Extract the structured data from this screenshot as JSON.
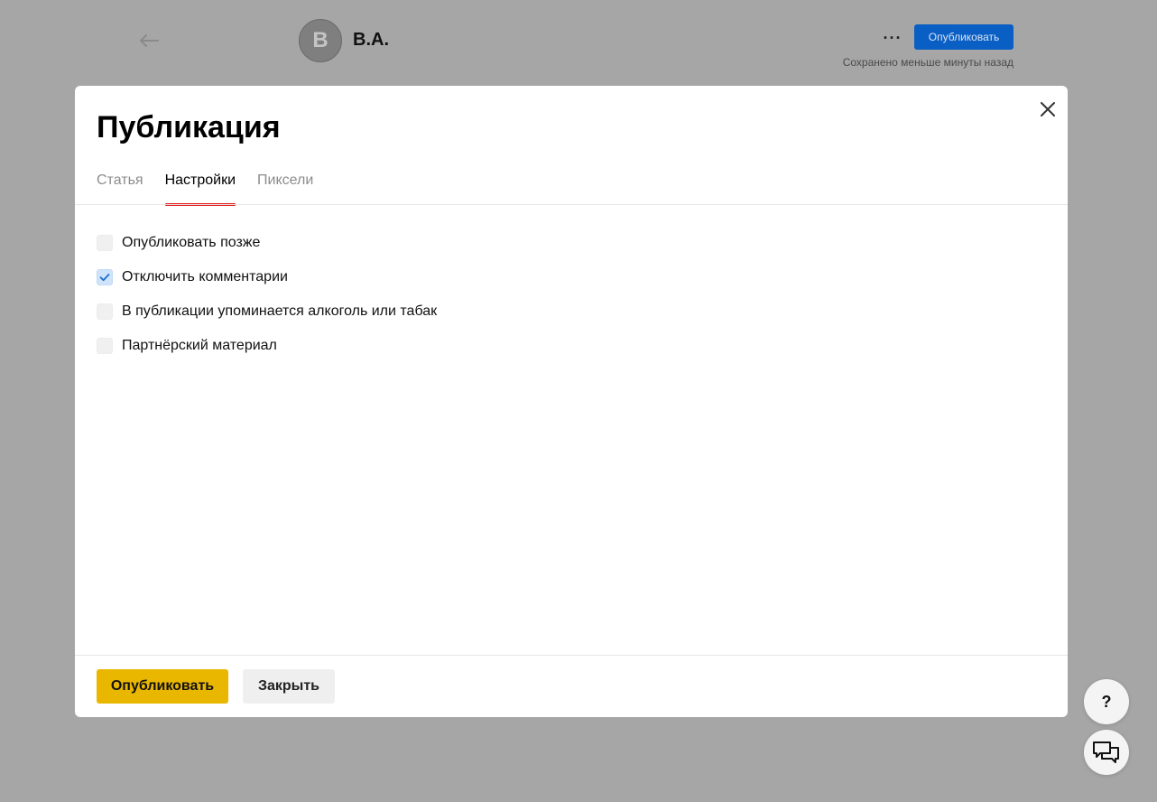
{
  "header": {
    "back_icon": "arrow-left-icon",
    "avatar_letter": "B",
    "author_name": "B.A.",
    "more_icon": "more-dots-icon",
    "more_text": "···",
    "publish_label": "Опубликовать",
    "saved_status": "Сохранено меньше минуты назад"
  },
  "modal": {
    "title": "Публикация",
    "close_icon": "close-icon",
    "tabs": [
      {
        "label": "Статья",
        "active": false
      },
      {
        "label": "Настройки",
        "active": true
      },
      {
        "label": "Пиксели",
        "active": false
      }
    ],
    "options": [
      {
        "label": "Опубликовать позже",
        "checked": false
      },
      {
        "label": "Отключить комментарии",
        "checked": true
      },
      {
        "label": "В публикации упоминается алкоголь или табак",
        "checked": false
      },
      {
        "label": "Партнёрский материал",
        "checked": false
      }
    ],
    "publish_button": "Опубликовать",
    "close_button": "Закрыть"
  },
  "floating": {
    "help_label": "?",
    "chat_icon": "chat-bubbles-icon"
  },
  "colors": {
    "overlay": "#a6a6a6",
    "top_publish": "#0a5fc4",
    "primary_button": "#eab700",
    "active_tab_underline": "#e41c1c",
    "checkbox_checked": "#cfe4fb",
    "checkmark": "#1f6fd1"
  }
}
